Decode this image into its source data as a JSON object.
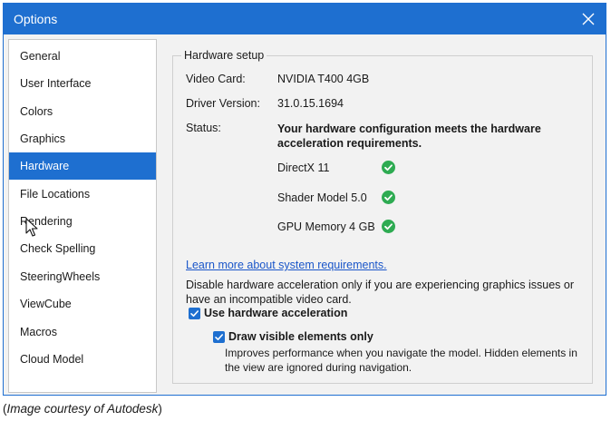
{
  "window": {
    "title": "Options",
    "accent": "#1e6fd0"
  },
  "sidebar": {
    "items": [
      {
        "label": "General"
      },
      {
        "label": "User Interface"
      },
      {
        "label": "Colors"
      },
      {
        "label": "Graphics"
      },
      {
        "label": "Hardware",
        "selected": true
      },
      {
        "label": "File Locations"
      },
      {
        "label": "Rendering"
      },
      {
        "label": "Check Spelling"
      },
      {
        "label": "SteeringWheels"
      },
      {
        "label": "ViewCube"
      },
      {
        "label": "Macros"
      },
      {
        "label": "Cloud Model"
      }
    ]
  },
  "hardware": {
    "group_title": "Hardware setup",
    "video_card_label": "Video Card:",
    "video_card_value": "NVIDIA T400 4GB",
    "driver_label": "Driver Version:",
    "driver_value": "31.0.15.1694",
    "status_label": "Status:",
    "status_value": "Your hardware configuration meets the hardware acceleration requirements.",
    "checks": [
      {
        "label": "DirectX 11",
        "icon": "check-circle-icon",
        "color": "#2eab52"
      },
      {
        "label": "Shader Model 5.0",
        "icon": "check-circle-icon",
        "color": "#2eab52"
      },
      {
        "label": "GPU Memory 4 GB",
        "icon": "check-circle-icon",
        "color": "#2eab52"
      }
    ],
    "learn_more": "Learn more about system requirements.",
    "disable_info": "Disable hardware acceleration only if you are experiencing graphics issues or have an incompatible video card.",
    "use_hw_accel_label": "Use hardware acceleration",
    "use_hw_accel_checked": true,
    "draw_visible_label": "Draw visible elements only",
    "draw_visible_checked": true,
    "draw_visible_desc": "Improves performance when you navigate the model. Hidden elements in the view are ignored during navigation."
  },
  "caption": {
    "open": "(",
    "text": "Image courtesy of Autodesk",
    "close": ")"
  }
}
